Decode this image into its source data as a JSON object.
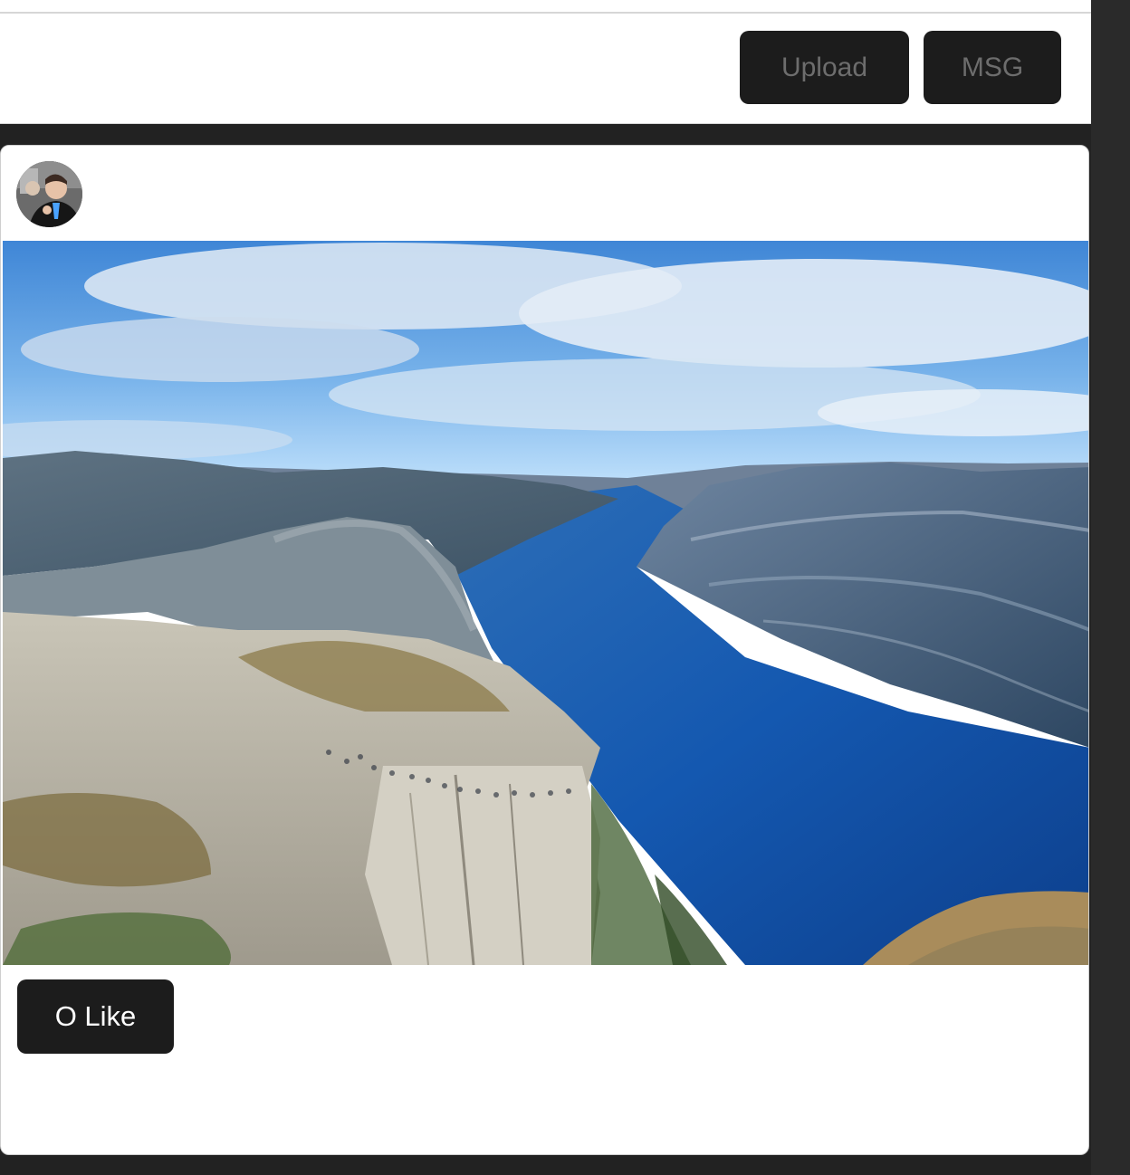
{
  "header": {
    "upload_label": "Upload",
    "msg_label": "MSG"
  },
  "post": {
    "avatar_icon": "user-avatar",
    "photo_icon": "fjord-landscape-photo",
    "like_label": "O Like"
  },
  "colors": {
    "page_background": "#222222",
    "button_background": "#1c1c1c",
    "header_button_text": "#6d6d6d",
    "like_text": "#ffffff"
  }
}
